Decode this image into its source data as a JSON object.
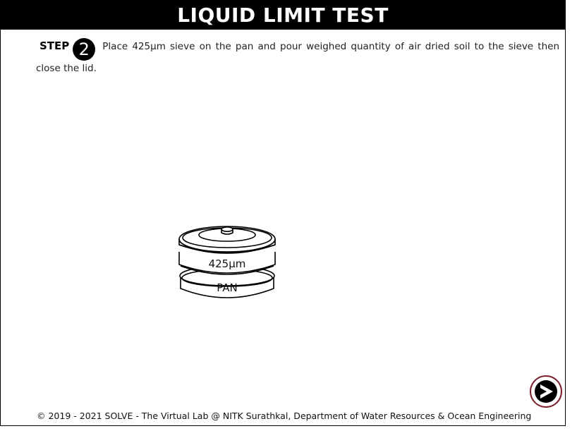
{
  "header": {
    "title": "LIQUID LIMIT TEST"
  },
  "step": {
    "label": "STEP",
    "number": "2",
    "instruction": "Place 425µm sieve on the pan and pour weighed quantity of air dried soil to the sieve then close the lid."
  },
  "apparatus": {
    "sieve_label": "425µm",
    "pan_label": "PAN"
  },
  "navigation": {
    "next_icon": "next-arrow-icon"
  },
  "footer": {
    "copyright": "© 2019 - 2021 SOLVE - The Virtual Lab @ NITK Surathkal, Department of Water Resources & Ocean Engineering"
  }
}
